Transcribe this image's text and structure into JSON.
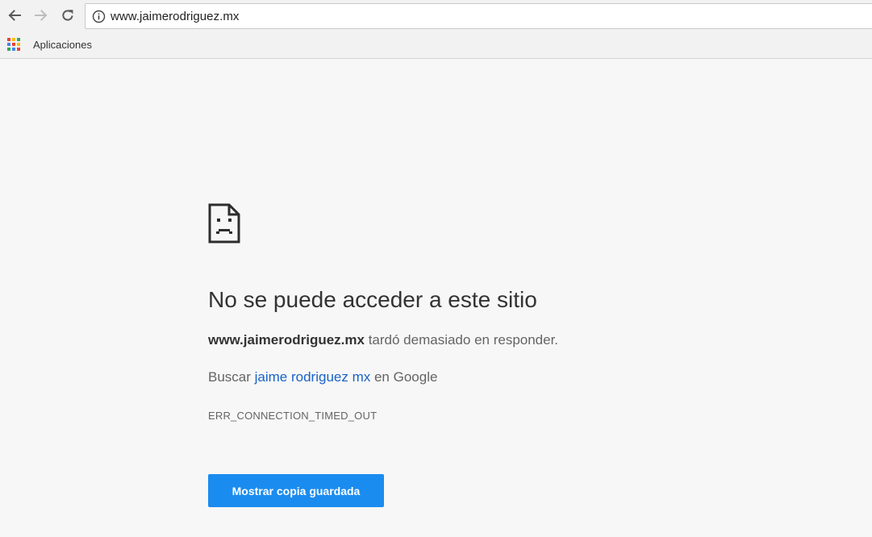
{
  "browser": {
    "back_icon": "back-arrow-icon",
    "forward_icon": "forward-arrow-icon",
    "reload_icon": "reload-icon",
    "info_icon": "info-icon",
    "url": "www.jaimerodriguez.mx"
  },
  "bookmarks_bar": {
    "apps_icon": "apps-grid-icon",
    "apps_label": "Aplicaciones",
    "apps_colors": [
      "#ea4335",
      "#fbbc05",
      "#34a853",
      "#4285f4",
      "#ea4335",
      "#fbbc05",
      "#34a853",
      "#4285f4",
      "#ea4335"
    ]
  },
  "error_page": {
    "icon": "sad-document-icon",
    "title": "No se puede acceder a este sitio",
    "summary_host": "www.jaimerodriguez.mx",
    "summary_text": " tardó demasiado en responder.",
    "suggestion_prefix": "Buscar ",
    "suggestion_link": "jaime rodriguez mx",
    "suggestion_suffix": " en Google",
    "error_code": "ERR_CONNECTION_TIMED_OUT",
    "button_label": "Mostrar copia guardada",
    "button_color": "#1a8cf0",
    "link_color": "#1a62c7"
  }
}
